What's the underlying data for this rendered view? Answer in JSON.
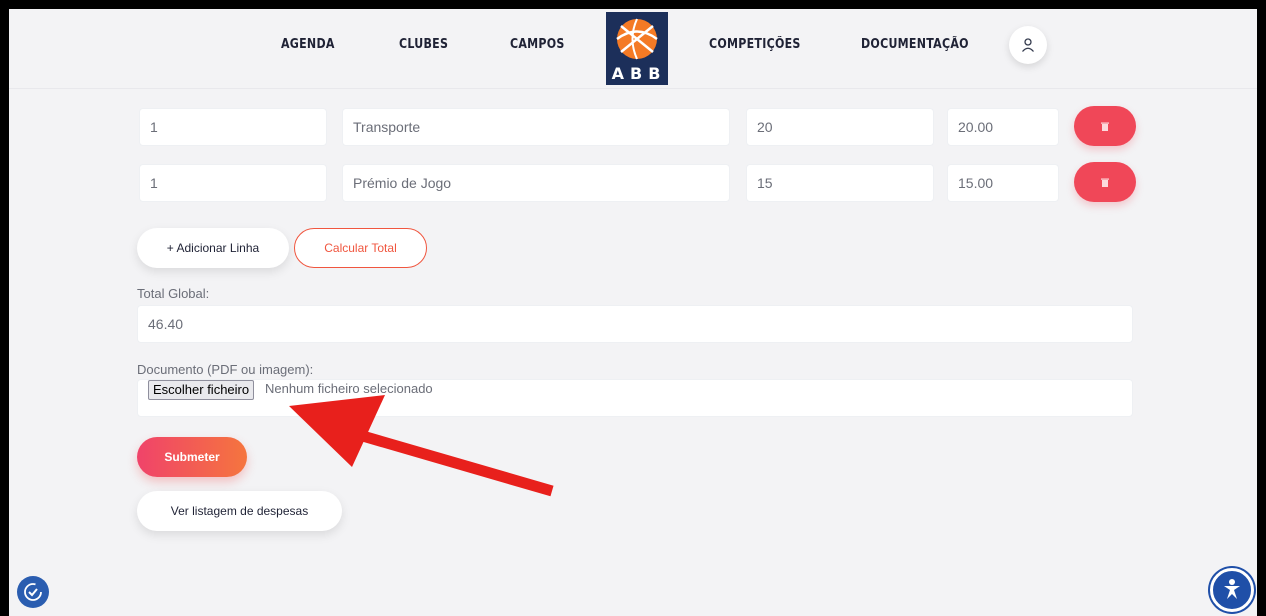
{
  "nav": {
    "items": [
      "AGENDA",
      "CLUBES",
      "CAMPOS",
      "COMPETIÇÕES",
      "DOCUMENTAÇÃO"
    ],
    "logo_text": "ABB"
  },
  "expense_rows": [
    {
      "qty": "1",
      "description": "Transporte",
      "value": "20",
      "total": "20.00"
    },
    {
      "qty": "1",
      "description": "Prémio de Jogo",
      "value": "15",
      "total": "15.00"
    }
  ],
  "buttons": {
    "add_line": "+ Adicionar Linha",
    "calc_total": "Calcular Total",
    "submit": "Submeter",
    "view_list": "Ver listagem de despesas"
  },
  "total": {
    "label": "Total Global:",
    "value": "46.40"
  },
  "document": {
    "label": "Documento (PDF ou imagem):",
    "choose_button": "Escolher ficheiro",
    "status": "Nenhum ficheiro selecionado"
  },
  "colors": {
    "accent_red": "#f04758",
    "accent_orange": "#f0563f",
    "arrow": "#e8201c",
    "logo_navy": "#1c2f5a"
  }
}
